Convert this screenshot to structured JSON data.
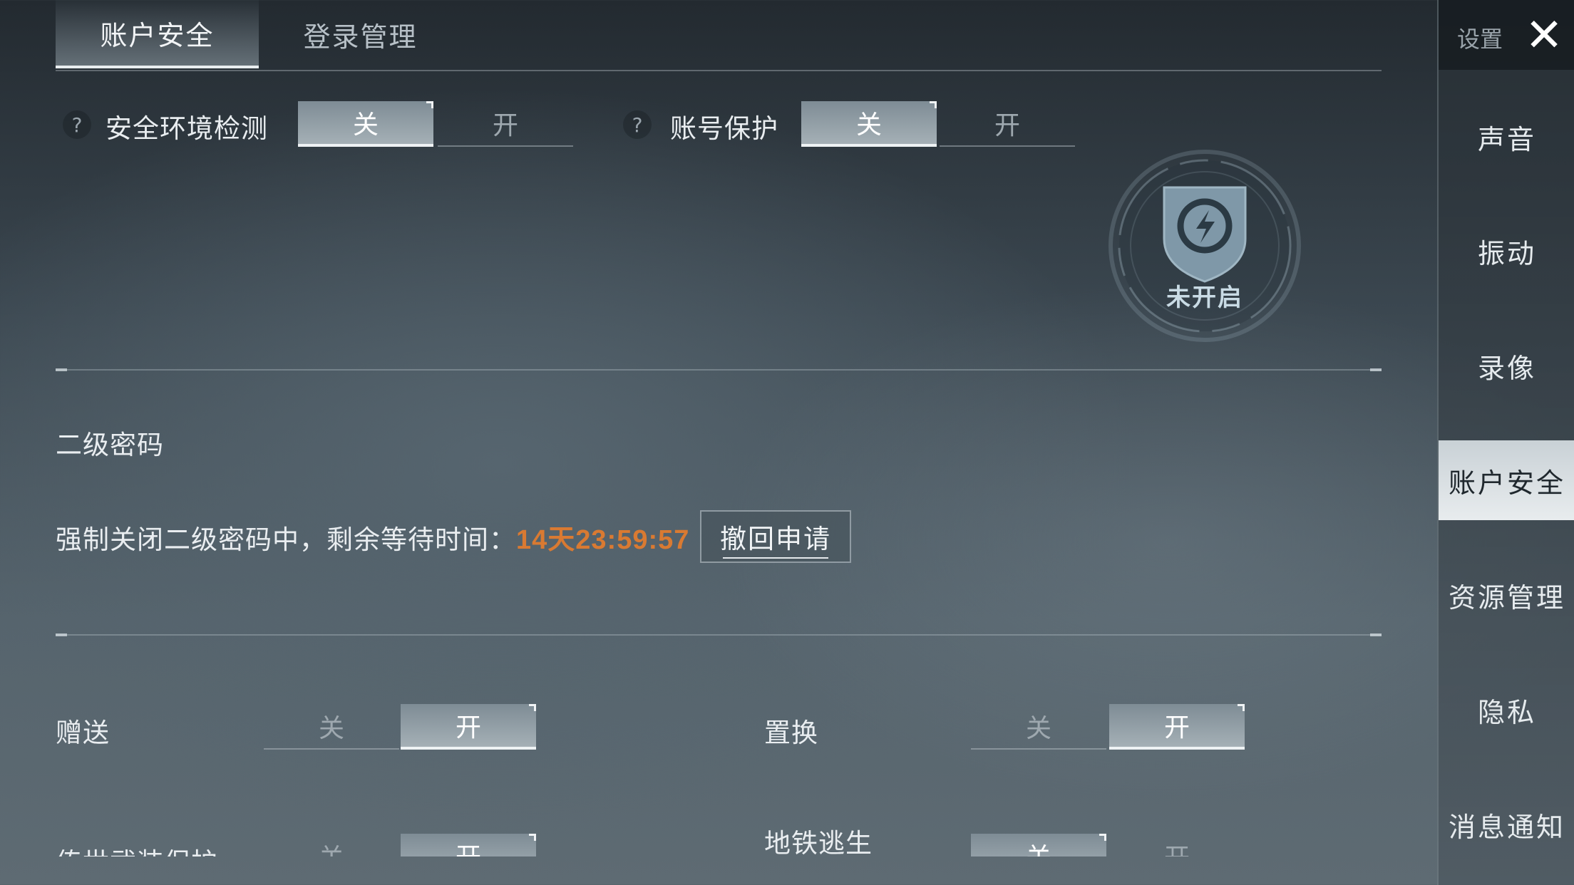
{
  "tabs": {
    "account_security": "账户安全",
    "login_management": "登录管理"
  },
  "help_icon": "?",
  "security_env": {
    "label": "安全环境检测",
    "off": "关",
    "on": "开",
    "selected": "off"
  },
  "account_protect": {
    "label": "账号保护",
    "off": "关",
    "on": "开",
    "selected": "off"
  },
  "badge": {
    "status": "未开启"
  },
  "secondary_password": {
    "title": "二级密码",
    "status_text": "强制关闭二级密码中，剩余等待时间：",
    "countdown": "14天23:59:57",
    "revoke_button": "撤回申请"
  },
  "gift": {
    "label": "赠送",
    "off": "关",
    "on": "开",
    "selected": "on"
  },
  "exchange": {
    "label": "置换",
    "off": "关",
    "on": "开",
    "selected": "on"
  },
  "legend_gear": {
    "label": "传世武装保护",
    "off": "关",
    "on": "开",
    "selected": "on"
  },
  "metro": {
    "label": "地铁逃生",
    "off": "关",
    "on": "开",
    "selected": "off"
  },
  "sidebar": {
    "title": "设置",
    "close_icon": "close-icon",
    "items": [
      {
        "label": "声音"
      },
      {
        "label": "振动"
      },
      {
        "label": "录像"
      },
      {
        "label": "账户安全",
        "active": true
      },
      {
        "label": "资源管理"
      },
      {
        "label": "隐私"
      },
      {
        "label": "消息通知"
      }
    ]
  },
  "colors": {
    "countdown": "#d97a32",
    "active_toggle": "#a5b0b6",
    "active_sidebar": "#e8ecee"
  }
}
